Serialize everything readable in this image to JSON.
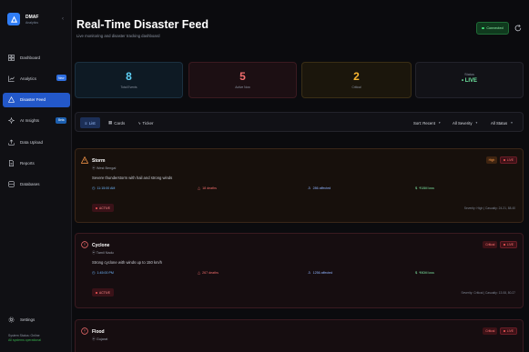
{
  "brand": {
    "name": "DMAF",
    "sub": "Analytics"
  },
  "sidebar": {
    "items": [
      {
        "label": "Dashboard"
      },
      {
        "label": "Analytics",
        "badge": "New"
      },
      {
        "label": "Disaster Feed"
      },
      {
        "label": "AI Insights",
        "badge": "Beta"
      },
      {
        "label": "Data Upload"
      },
      {
        "label": "Reports"
      },
      {
        "label": "Databases"
      }
    ],
    "settings": "Settings",
    "system_status": "System Status: Online",
    "system_ok": "All systems operational"
  },
  "header": {
    "title": "Real-Time Disaster Feed",
    "subtitle": "Live monitoring and disaster tracking dashboard",
    "connected": "Connected"
  },
  "stats": {
    "total": {
      "value": "8",
      "label": "Total Events"
    },
    "active": {
      "value": "5",
      "label": "Active Now"
    },
    "critical": {
      "value": "2",
      "label": "Critical"
    },
    "status": {
      "label": "Status",
      "value": "• LIVE"
    }
  },
  "toolbar": {
    "views": [
      "List",
      "Cards",
      "Ticker"
    ],
    "sort": "Sort: Recent",
    "severity": "All Severity",
    "status": "All Status"
  },
  "events": [
    {
      "name": "Storm",
      "location": "West Bengal",
      "description": "Severe thunderstorm with hail and strong winds",
      "time": "11:15:00 AM",
      "deaths": "18 deaths",
      "affected": "286 affected",
      "loss": "₹18M loss",
      "status": "ACTIVE",
      "severity_badge": "High",
      "live": "LIVE",
      "severity_line": "Severity: High | Casualty: 24.21, 88.40"
    },
    {
      "name": "Cyclone",
      "location": "Tamil Nadu",
      "description": "Strong cyclone with winds up to 150 km/h",
      "time": "1:45:00 PM",
      "deaths": "267 deaths",
      "affected": "1256 affected",
      "loss": "₹80M loss",
      "status": "ACTIVE",
      "severity_badge": "Critical",
      "live": "LIVE",
      "severity_line": "Severity: Critical | Casualty: 13.08, 80.27"
    },
    {
      "name": "Flood",
      "location": "Gujarat",
      "severity_badge": "Critical",
      "live": "LIVE"
    }
  ]
}
